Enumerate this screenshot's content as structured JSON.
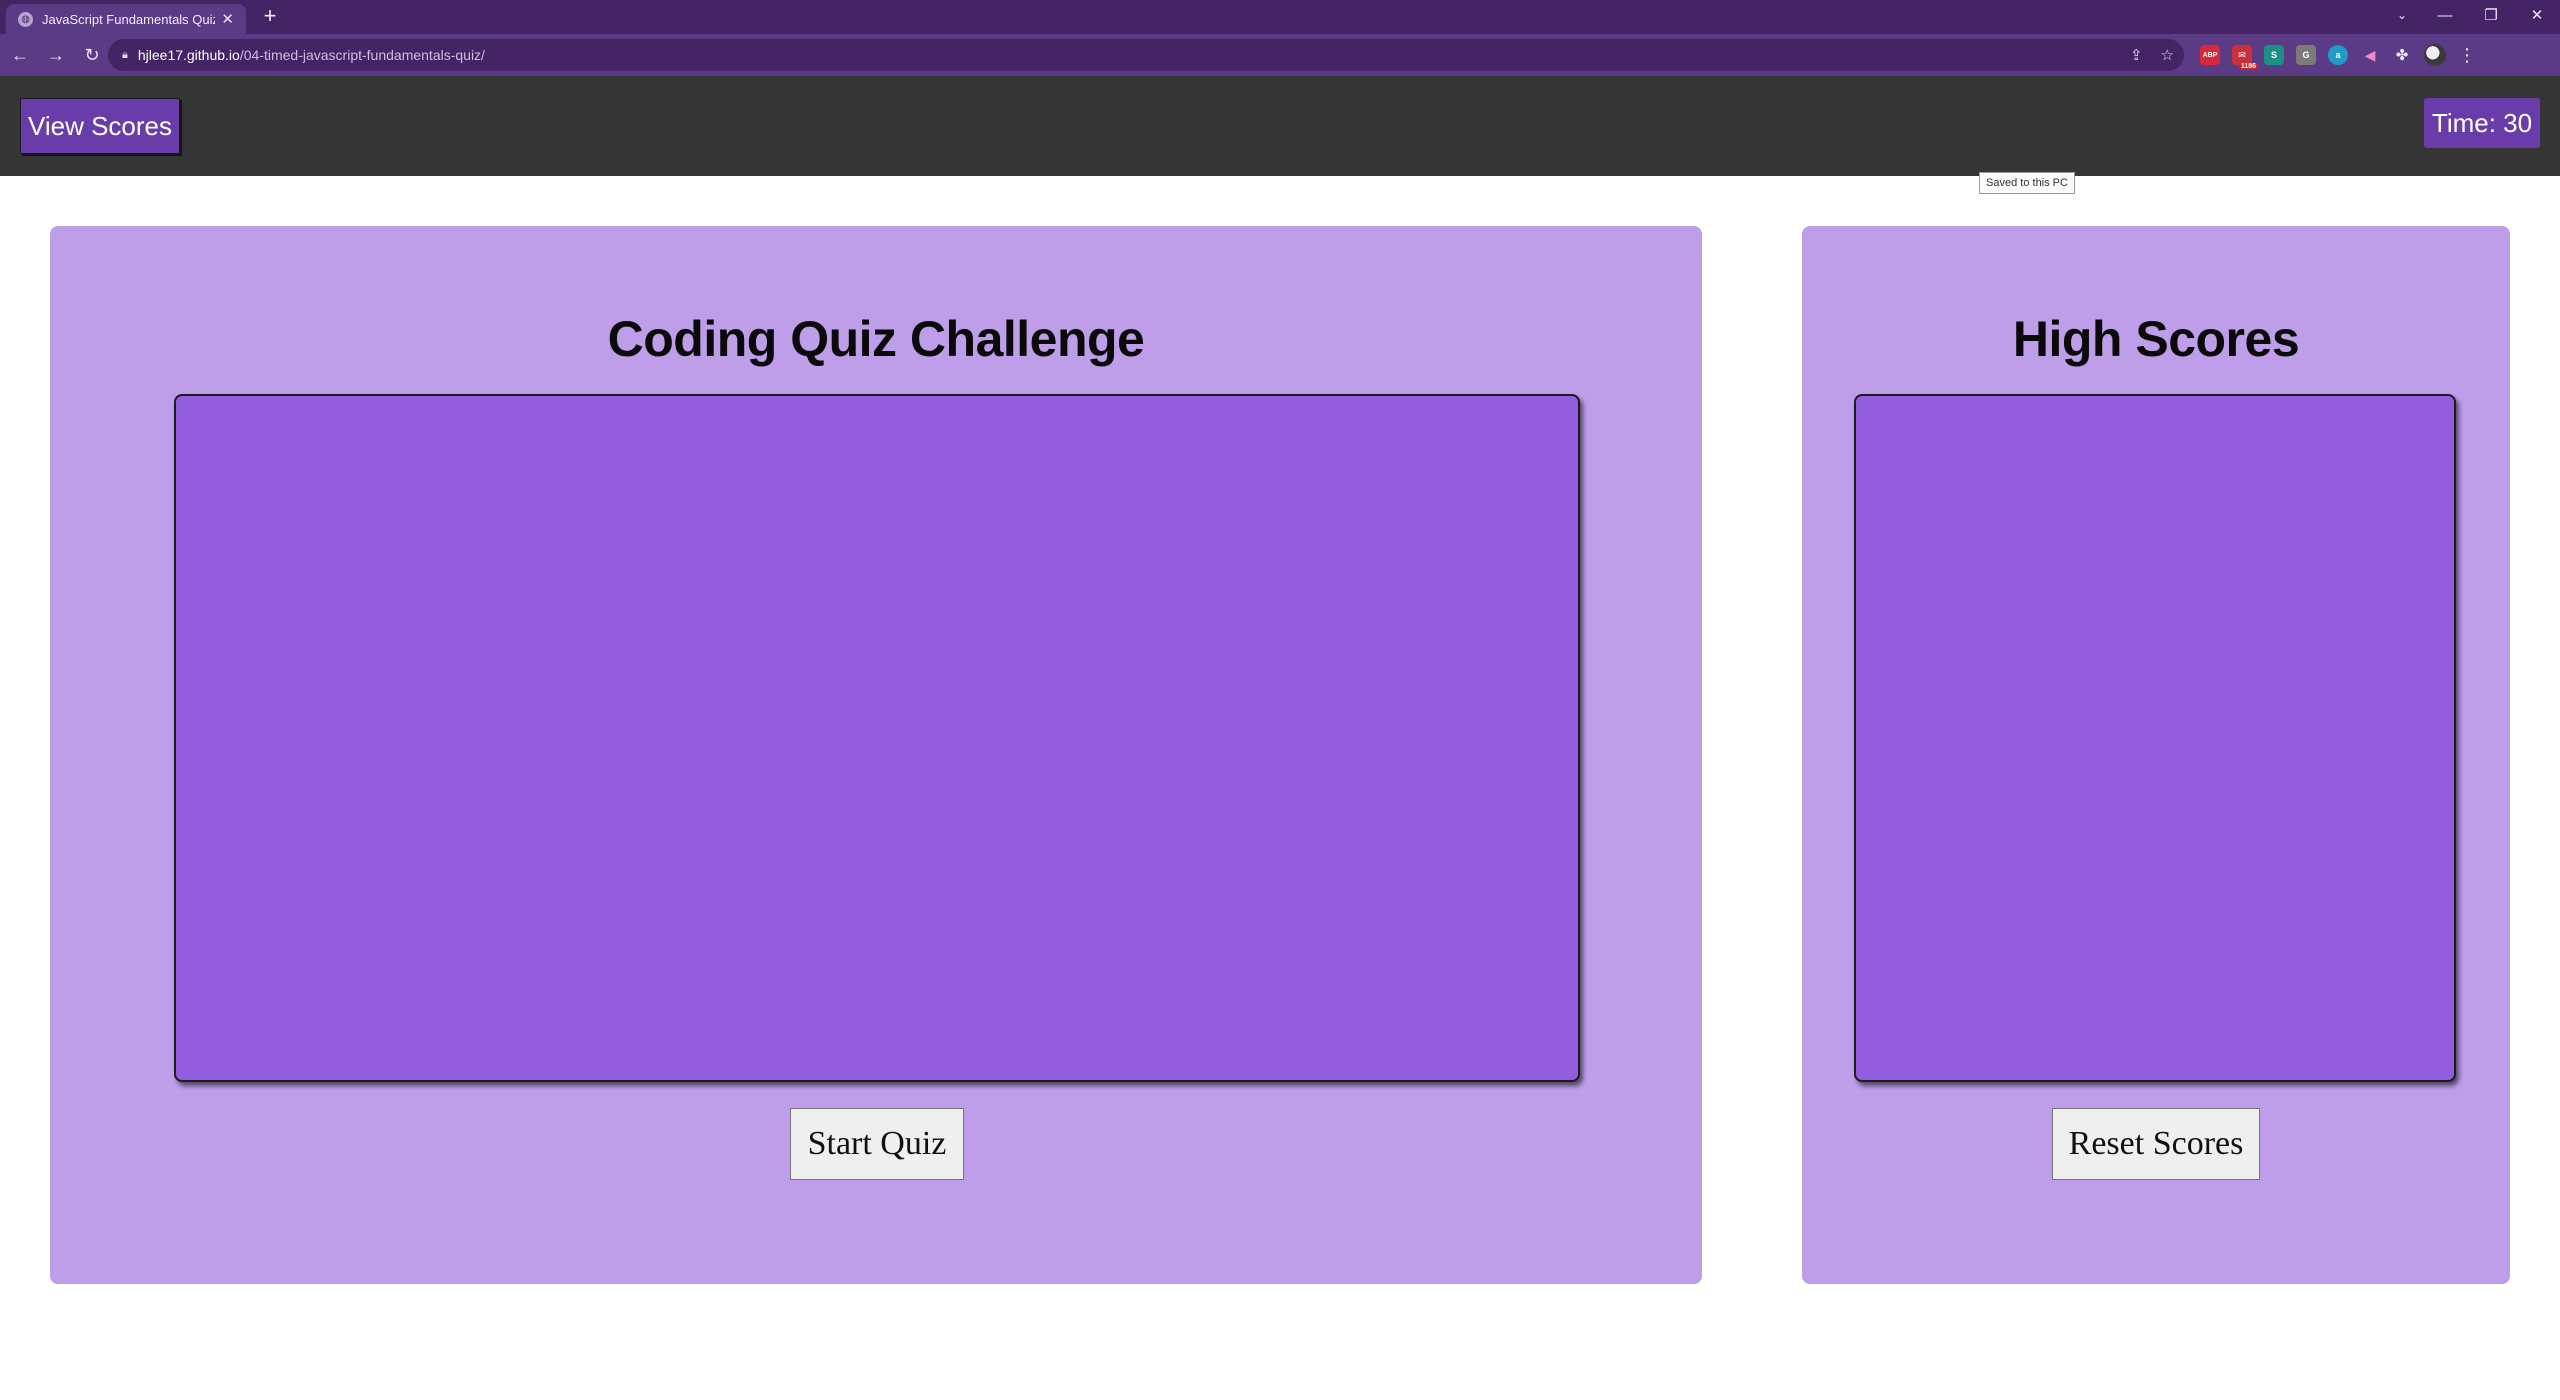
{
  "browser": {
    "tab_title": "JavaScript Fundamentals Quiz",
    "tab_close": "✕",
    "new_tab": "+",
    "url_host": "hjlee17.github.io",
    "url_path": "/04-timed-javascript-fundamentals-quiz/",
    "tooltip": "Saved to this PC",
    "extensions": [
      "ABP",
      "1186",
      "S",
      "G",
      "a"
    ]
  },
  "header": {
    "view_scores_label": "View Scores",
    "timer_label": "Time: 30"
  },
  "quiz_panel": {
    "title": "Coding Quiz Challenge",
    "start_button": "Start Quiz"
  },
  "scores_panel": {
    "title": "High Scores",
    "reset_button": "Reset Scores"
  },
  "colors": {
    "header_bg": "#353535",
    "button_purple": "#6a3ca9",
    "panel_bg": "#be9ee8",
    "content_bg": "#945ddf",
    "chrome_tabbar": "#442465",
    "chrome_toolbar": "#5b3a86"
  }
}
